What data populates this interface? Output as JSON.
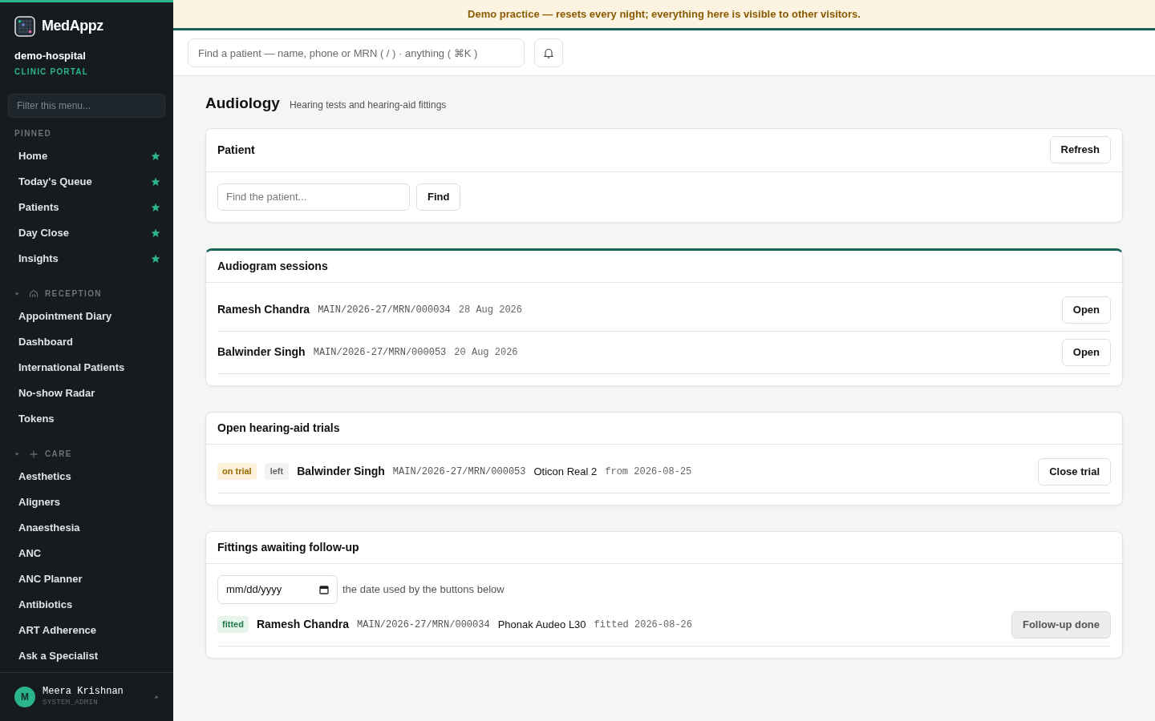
{
  "sidebar": {
    "brand": "MedAppz",
    "org": "demo-hospital",
    "org_sub": "CLINIC PORTAL",
    "filter_placeholder": "Filter this menu...",
    "groups": [
      {
        "label": "PINNED",
        "kind": "pinned",
        "items": [
          {
            "label": "Home",
            "pinned": true
          },
          {
            "label": "Today's Queue",
            "pinned": true
          },
          {
            "label": "Patients",
            "pinned": true
          },
          {
            "label": "Day Close",
            "pinned": true
          },
          {
            "label": "Insights",
            "pinned": true
          }
        ]
      },
      {
        "label": "RECEPTION",
        "kind": "section",
        "expanded": true,
        "items": [
          {
            "label": "Appointment Diary",
            "pinned": false
          },
          {
            "label": "Dashboard",
            "pinned": false
          },
          {
            "label": "International Patients",
            "pinned": false
          },
          {
            "label": "No-show Radar",
            "pinned": false
          },
          {
            "label": "Tokens",
            "pinned": false
          }
        ]
      },
      {
        "label": "CARE",
        "kind": "section",
        "expanded": true,
        "items": [
          {
            "label": "Aesthetics",
            "pinned": false
          },
          {
            "label": "Aligners",
            "pinned": false
          },
          {
            "label": "Anaesthesia",
            "pinned": false
          },
          {
            "label": "ANC",
            "pinned": false
          },
          {
            "label": "ANC Planner",
            "pinned": false
          },
          {
            "label": "Antibiotics",
            "pinned": false
          },
          {
            "label": "ART Adherence",
            "pinned": false
          },
          {
            "label": "Ask a Specialist",
            "pinned": false
          }
        ]
      }
    ],
    "user": {
      "initial": "M",
      "name": "Meera Krishnan",
      "role": "SYSTEM_ADMIN"
    }
  },
  "banner": "Demo practice — resets every night; everything here is visible to other visitors.",
  "search": {
    "placeholder": "Find a patient — name, phone or MRN ( / ) · anything ( ⌘K )"
  },
  "page": {
    "title": "Audiology",
    "subtitle": "Hearing tests and hearing-aid fittings"
  },
  "sections": [
    {
      "kind": "patient",
      "title": "Patient",
      "highlighted": false,
      "header_button": "Refresh",
      "field_placeholder": "Find the patient...",
      "button": "Find"
    },
    {
      "kind": "sessions",
      "title": "Audiogram sessions",
      "highlighted": true,
      "rows": [
        {
          "name": "Ramesh Chandra",
          "mrn": "MAIN/2026-27/MRN/000034",
          "date": "28 Aug 2026",
          "button": "Open",
          "disabled": false
        },
        {
          "name": "Balwinder Singh",
          "mrn": "MAIN/2026-27/MRN/000053",
          "date": "20 Aug 2026",
          "button": "Open",
          "disabled": false
        }
      ]
    },
    {
      "kind": "trials",
      "title": "Open hearing-aid trials",
      "highlighted": false,
      "rows": [
        {
          "status": "on trial",
          "side": "left",
          "name": "Balwinder Singh",
          "mrn": "MAIN/2026-27/MRN/000053",
          "device": "Oticon Real 2",
          "date": "from 2026-08-25",
          "button": "Close trial",
          "disabled": false
        }
      ]
    },
    {
      "kind": "fittings",
      "title": "Fittings awaiting follow-up",
      "highlighted": false,
      "date_value": "mm/dd/yyyy",
      "date_hint": "the date used by the buttons below",
      "rows": [
        {
          "status": "fitted",
          "name": "Ramesh Chandra",
          "mrn": "MAIN/2026-27/MRN/000034",
          "device": "Phonak Audeo L30",
          "date": "fitted 2026-08-26",
          "button": "Follow-up done",
          "disabled": true
        }
      ]
    }
  ]
}
